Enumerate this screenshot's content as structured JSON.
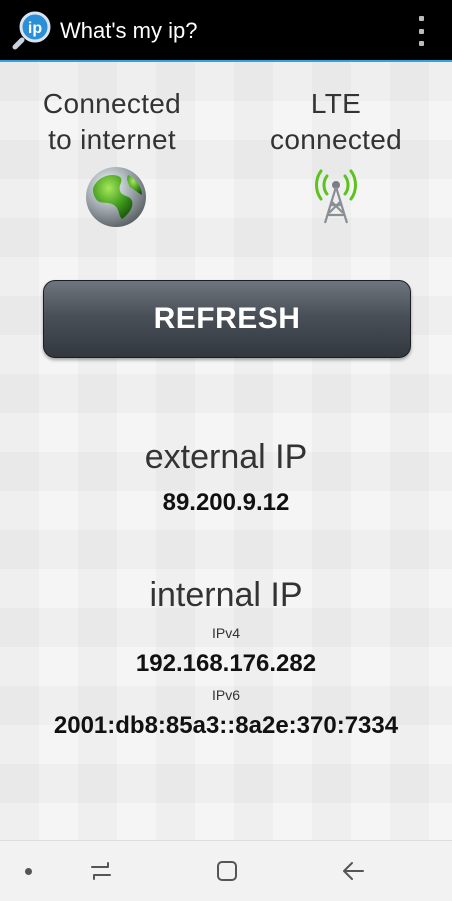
{
  "appbar": {
    "title": "What's my ip?",
    "logo_text": "ip",
    "logo_icon": "magnifier-ip-icon",
    "menu_icon": "more-vert-icon"
  },
  "status": {
    "internet": {
      "line1": "Connected",
      "line2": "to internet",
      "icon": "globe-icon"
    },
    "network": {
      "line1": "LTE",
      "line2": "connected",
      "icon": "cell-tower-icon"
    }
  },
  "refresh_label": "REFRESH",
  "external": {
    "label": "external IP",
    "value": "89.200.9.12"
  },
  "internal": {
    "label": "internal IP",
    "ipv4_label": "IPv4",
    "ipv4_value": "192.168.176.282",
    "ipv6_label": "IPv6",
    "ipv6_value": "2001:db8:85a3::8a2e:370:7334"
  },
  "navbar": {
    "icons": [
      "dot-icon",
      "recent-apps-icon",
      "home-icon",
      "back-icon"
    ]
  },
  "colors": {
    "accent": "#2aa6e0",
    "appbar_bg": "#000000",
    "button_top": "#6f757e",
    "button_bottom": "#33383f"
  }
}
